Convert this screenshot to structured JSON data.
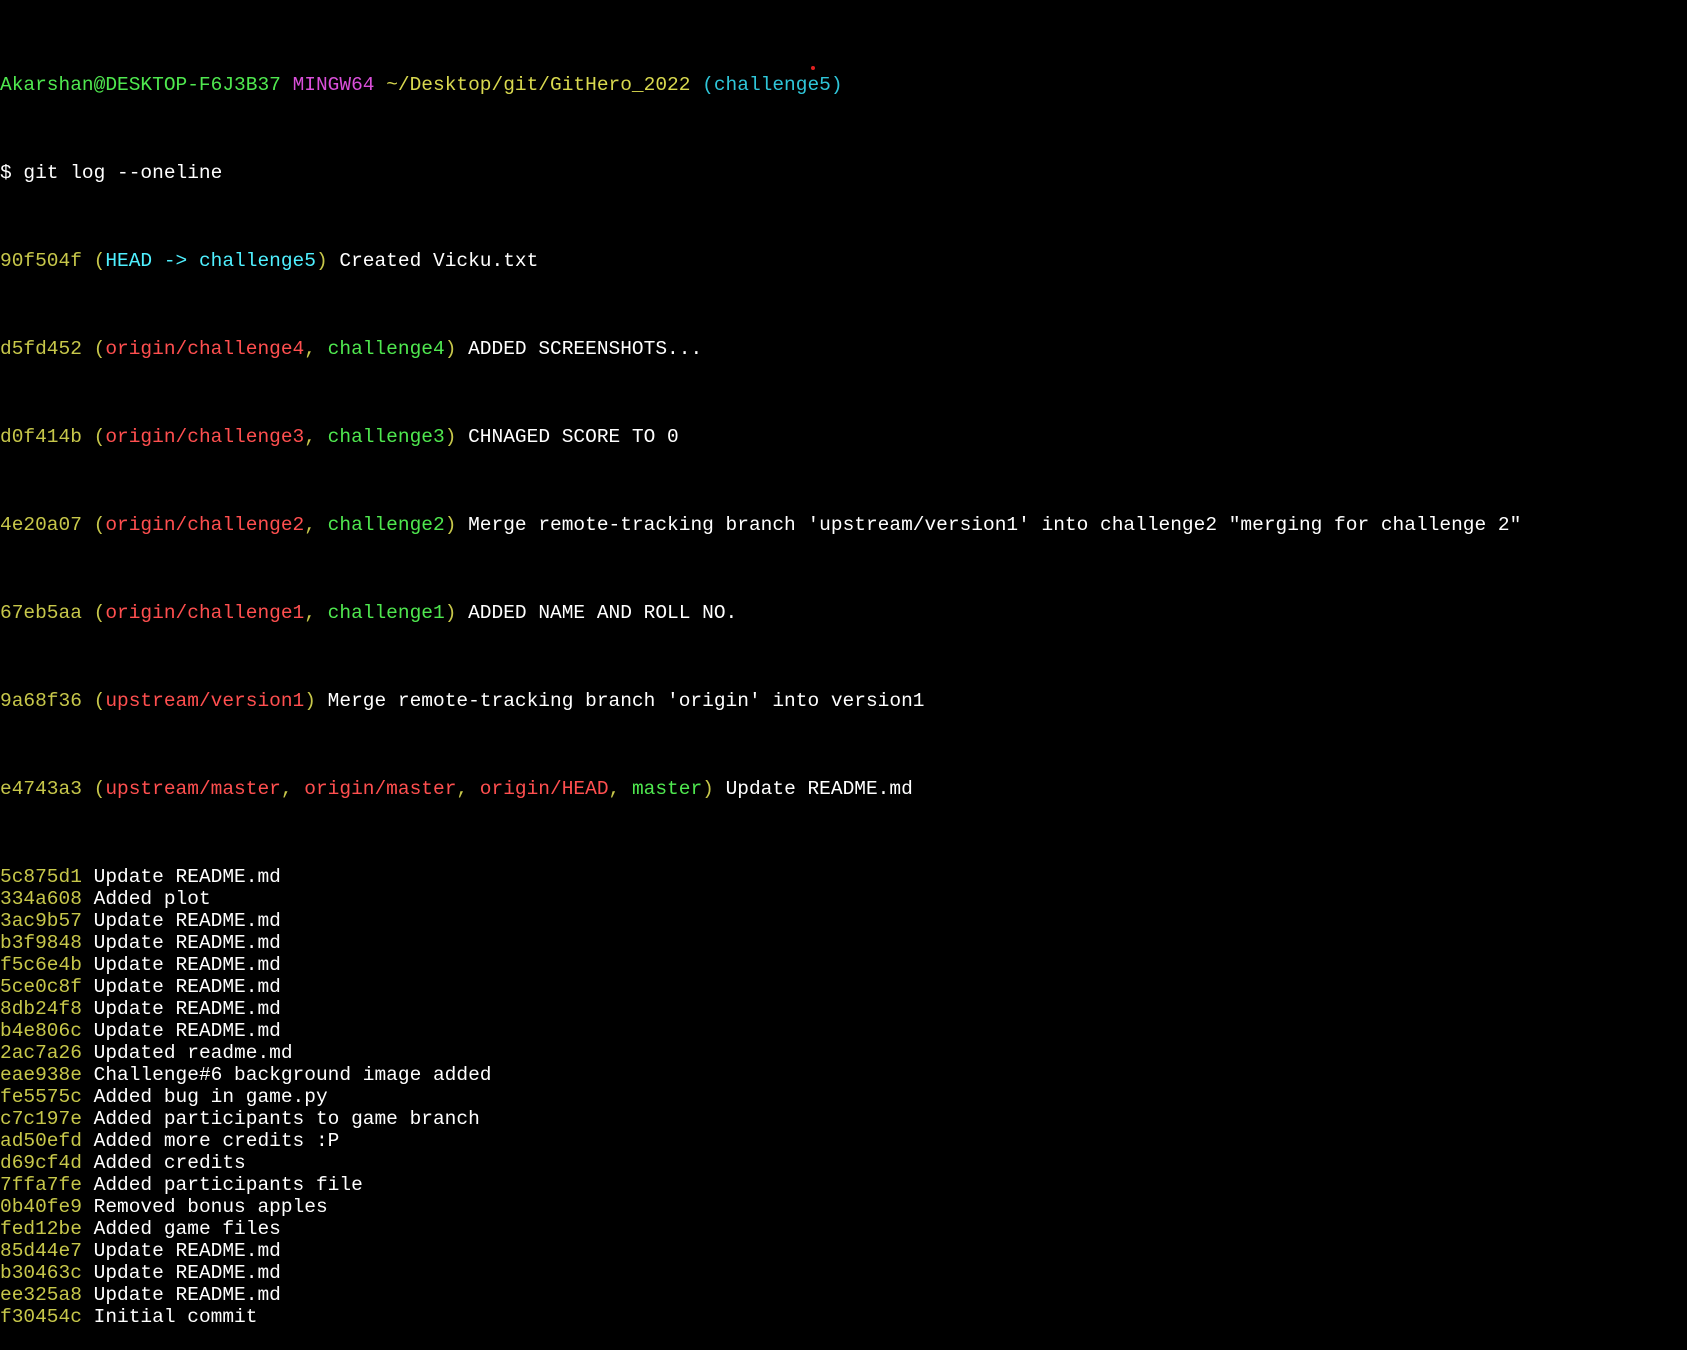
{
  "prompt": {
    "user_host": "Akarshan@DESKTOP-F6J3B37",
    "shell": "MINGW64",
    "path": "~/Desktop/git/GitHero_2022",
    "branch": "(challenge5)",
    "command": "$ git log --oneline"
  },
  "decorated": {
    "l1": {
      "hash": "90f504f",
      "head": "HEAD -> challenge5",
      "msg": "Created Vicku.txt"
    },
    "l2": {
      "hash": "d5fd452",
      "remote": "origin/challenge4",
      "local": "challenge4",
      "msg": "ADDED SCREENSHOTS..."
    },
    "l3": {
      "hash": "d0f414b",
      "remote": "origin/challenge3",
      "local": "challenge3",
      "msg": "CHNAGED SCORE TO 0"
    },
    "l4": {
      "hash": "4e20a07",
      "remote": "origin/challenge2",
      "local": "challenge2",
      "msg": "Merge remote-tracking branch 'upstream/version1' into challenge2 \"merging for challenge 2\""
    },
    "l5": {
      "hash": "67eb5aa",
      "remote": "origin/challenge1",
      "local": "challenge1",
      "msg": "ADDED NAME AND ROLL NO."
    },
    "l6": {
      "hash": "9a68f36",
      "remote": "upstream/version1",
      "msg": "Merge remote-tracking branch 'origin' into version1"
    },
    "l7": {
      "hash": "e4743a3",
      "r1": "upstream/master",
      "r2": "origin/master",
      "r3": "origin/HEAD",
      "local": "master",
      "msg": "Update README.md"
    }
  },
  "commits": [
    {
      "hash": "5c875d1",
      "msg": "Update README.md"
    },
    {
      "hash": "334a608",
      "msg": "Added plot"
    },
    {
      "hash": "3ac9b57",
      "msg": "Update README.md"
    },
    {
      "hash": "b3f9848",
      "msg": "Update README.md"
    },
    {
      "hash": "f5c6e4b",
      "msg": "Update README.md"
    },
    {
      "hash": "5ce0c8f",
      "msg": "Update README.md"
    },
    {
      "hash": "8db24f8",
      "msg": "Update README.md"
    },
    {
      "hash": "b4e806c",
      "msg": "Update README.md"
    },
    {
      "hash": "2ac7a26",
      "msg": "Updated readme.md"
    },
    {
      "hash": "eae938e",
      "msg": "Challenge#6 background image added"
    },
    {
      "hash": "fe5575c",
      "msg": "Added bug in game.py"
    },
    {
      "hash": "c7c197e",
      "msg": "Added participants to game branch"
    },
    {
      "hash": "ad50efd",
      "msg": "Added more credits :P"
    },
    {
      "hash": "d69cf4d",
      "msg": "Added credits"
    },
    {
      "hash": "7ffa7fe",
      "msg": "Added participants file"
    },
    {
      "hash": "0b40fe9",
      "msg": "Removed bonus apples"
    },
    {
      "hash": "fed12be",
      "msg": "Added game files"
    },
    {
      "hash": "85d44e7",
      "msg": "Update README.md"
    },
    {
      "hash": "b30463c",
      "msg": "Update README.md"
    },
    {
      "hash": "ee325a8",
      "msg": "Update README.md"
    },
    {
      "hash": "f30454c",
      "msg": "Initial commit"
    }
  ],
  "colors": {
    "background": "#000000",
    "hash": "#c7c74a",
    "remote_ref": "#ff4f4f",
    "local_branch": "#4fe84f",
    "head_ref": "#4ff0ff",
    "prompt_user": "#4fe84f",
    "prompt_shell": "#d94fd9",
    "prompt_path": "#d9d94f",
    "prompt_branch": "#2fc6d9"
  }
}
